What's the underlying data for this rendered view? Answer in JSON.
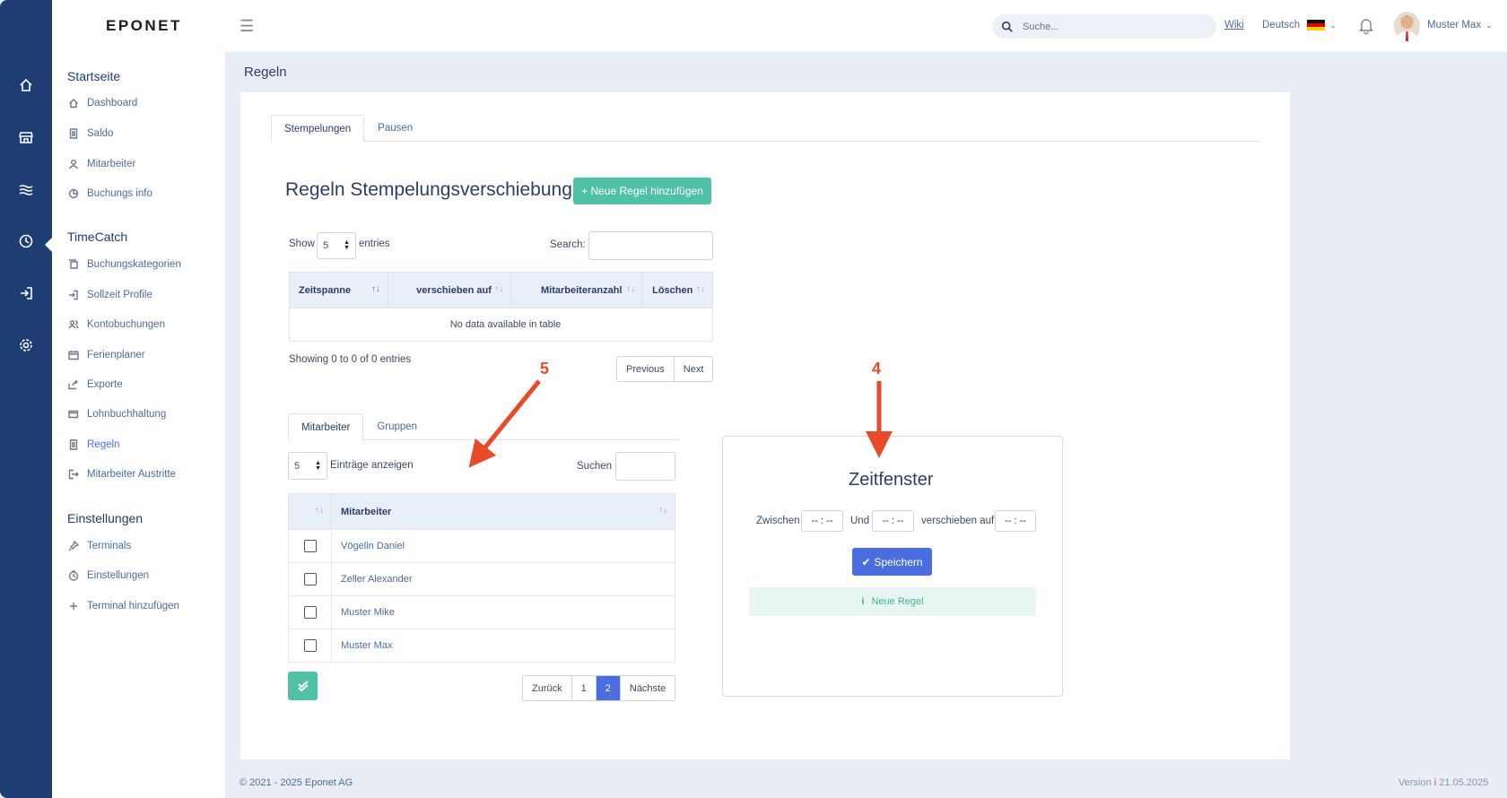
{
  "header": {
    "logo": "EPONET",
    "search_placeholder": "Suche...",
    "wiki": "Wiki",
    "language": "Deutsch",
    "user": "Muster Max"
  },
  "rail": [
    "home-icon",
    "store-icon",
    "waves-icon",
    "clock-icon",
    "login-icon",
    "gear-icon"
  ],
  "sidebar": {
    "sections": [
      {
        "title": "Startseite",
        "items": [
          {
            "label": "Dashboard",
            "icon": "home-icon"
          },
          {
            "label": "Saldo",
            "icon": "document-icon"
          },
          {
            "label": "Mitarbeiter",
            "icon": "user-icon"
          },
          {
            "label": "Buchungs info",
            "icon": "chart-icon"
          }
        ]
      },
      {
        "title": "TimeCatch",
        "items": [
          {
            "label": "Buchungskategorien",
            "icon": "copy-icon"
          },
          {
            "label": "Sollzeit Profile",
            "icon": "login-icon"
          },
          {
            "label": "Kontobuchungen",
            "icon": "users-icon"
          },
          {
            "label": "Ferienplaner",
            "icon": "calendar-icon"
          },
          {
            "label": "Exporte",
            "icon": "share-icon"
          },
          {
            "label": "Lohnbuchhaltung",
            "icon": "wallet-icon"
          },
          {
            "label": "Regeln",
            "icon": "document-icon",
            "active": true
          },
          {
            "label": "Mitarbeiter Austritte",
            "icon": "logout-icon"
          }
        ]
      },
      {
        "title": "Einstellungen",
        "items": [
          {
            "label": "Terminals",
            "icon": "pin-icon"
          },
          {
            "label": "Einstellungen",
            "icon": "timer-icon"
          },
          {
            "label": "Terminal hinzufügen",
            "icon": "plus-icon"
          }
        ]
      }
    ]
  },
  "page": {
    "title": "Regeln",
    "tabs": [
      "Stempelungen",
      "Pausen"
    ],
    "heading": "Regeln Stempelungsverschiebung",
    "add_button": "+ Neue Regel hinzufügen"
  },
  "rules_table": {
    "show": "Show",
    "entries_value": "5",
    "entries": "entries",
    "search_label": "Search:",
    "columns": [
      "Zeitspanne",
      "verschieben auf",
      "Mitarbeiteranzahl",
      "Löschen"
    ],
    "empty": "No data available in table",
    "info": "Showing 0 to 0 of 0 entries",
    "prev": "Previous",
    "next": "Next"
  },
  "employees": {
    "tabs": [
      "Mitarbeiter",
      "Gruppen"
    ],
    "entries_value": "5",
    "entries_label": "Einträge anzeigen",
    "search_label": "Suchen",
    "column": "Mitarbeiter",
    "rows": [
      "Vögelin Daniel",
      "Zeller Alexander",
      "Muster Mike",
      "Muster Max"
    ],
    "pager": [
      "Zurück",
      "1",
      "2",
      "Nächste"
    ],
    "current_page": "2"
  },
  "zeitfenster": {
    "title": "Zeitfenster",
    "zwischen": "Zwischen",
    "und": "Und",
    "verschieben": "verschieben auf",
    "time_placeholder": "-- : --",
    "save": "Speichern",
    "info": "Neue Regel"
  },
  "annotations": [
    "5",
    "4"
  ],
  "footer": {
    "copyright": "© 2021 - 2025 Eponet AG",
    "version_label": "Version",
    "version_icon": "i",
    "version_date": "21.05.2025"
  },
  "colors": {
    "rail": "#1d3d73",
    "accent_green": "#4fc1a6",
    "accent_blue": "#4a6ee0",
    "annotation": "#e84a2a"
  }
}
